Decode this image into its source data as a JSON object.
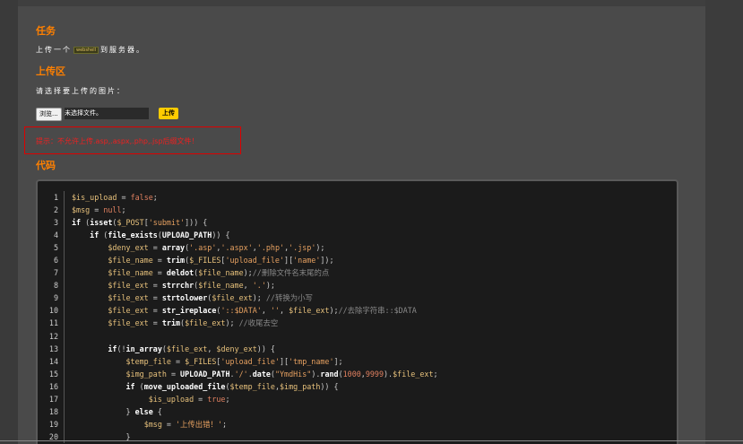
{
  "task": {
    "heading": "任务",
    "text_before": "上传一个",
    "tag": "webshell",
    "text_after": "到服务器。"
  },
  "upload_area": {
    "heading": "上传区",
    "prompt": "请选择要上传的图片：",
    "browse_label": "浏览...",
    "file_status": "未选择文件。",
    "upload_label": "上传"
  },
  "warning": "提示：不允许上传.asp,.aspx,.php,.jsp后缀文件！",
  "code_section": {
    "heading": "代码",
    "lines": [
      {
        "n": "1",
        "t": "$is_upload = false;"
      },
      {
        "n": "2",
        "t": "$msg = null;"
      },
      {
        "n": "3",
        "t": "if (isset($_POST['submit'])) {"
      },
      {
        "n": "4",
        "t": "    if (file_exists(UPLOAD_PATH)) {"
      },
      {
        "n": "5",
        "t": "        $deny_ext = array('.asp','.aspx','.php','.jsp');"
      },
      {
        "n": "6",
        "t": "        $file_name = trim($_FILES['upload_file']['name']);"
      },
      {
        "n": "7",
        "t": "        $file_name = deldot($file_name);//删除文件名末尾的点"
      },
      {
        "n": "8",
        "t": "        $file_ext = strrchr($file_name, '.');"
      },
      {
        "n": "9",
        "t": "        $file_ext = strtolower($file_ext); //转换为小写"
      },
      {
        "n": "10",
        "t": "        $file_ext = str_ireplace('::$DATA', '', $file_ext);//去除字符串::$DATA"
      },
      {
        "n": "11",
        "t": "        $file_ext = trim($file_ext); //收尾去空"
      },
      {
        "n": "12",
        "t": ""
      },
      {
        "n": "13",
        "t": "        if(!in_array($file_ext, $deny_ext)) {"
      },
      {
        "n": "14",
        "t": "            $temp_file = $_FILES['upload_file']['tmp_name'];"
      },
      {
        "n": "15",
        "t": "            $img_path = UPLOAD_PATH.'/'.date(\"YmdHis\").rand(1000,9999).$file_ext;"
      },
      {
        "n": "16",
        "t": "            if (move_uploaded_file($temp_file,$img_path)) {"
      },
      {
        "n": "17",
        "t": "                 $is_upload = true;"
      },
      {
        "n": "18",
        "t": "            } else {"
      },
      {
        "n": "19",
        "t": "                $msg = '上传出错！';"
      },
      {
        "n": "20",
        "t": "            }"
      }
    ]
  }
}
